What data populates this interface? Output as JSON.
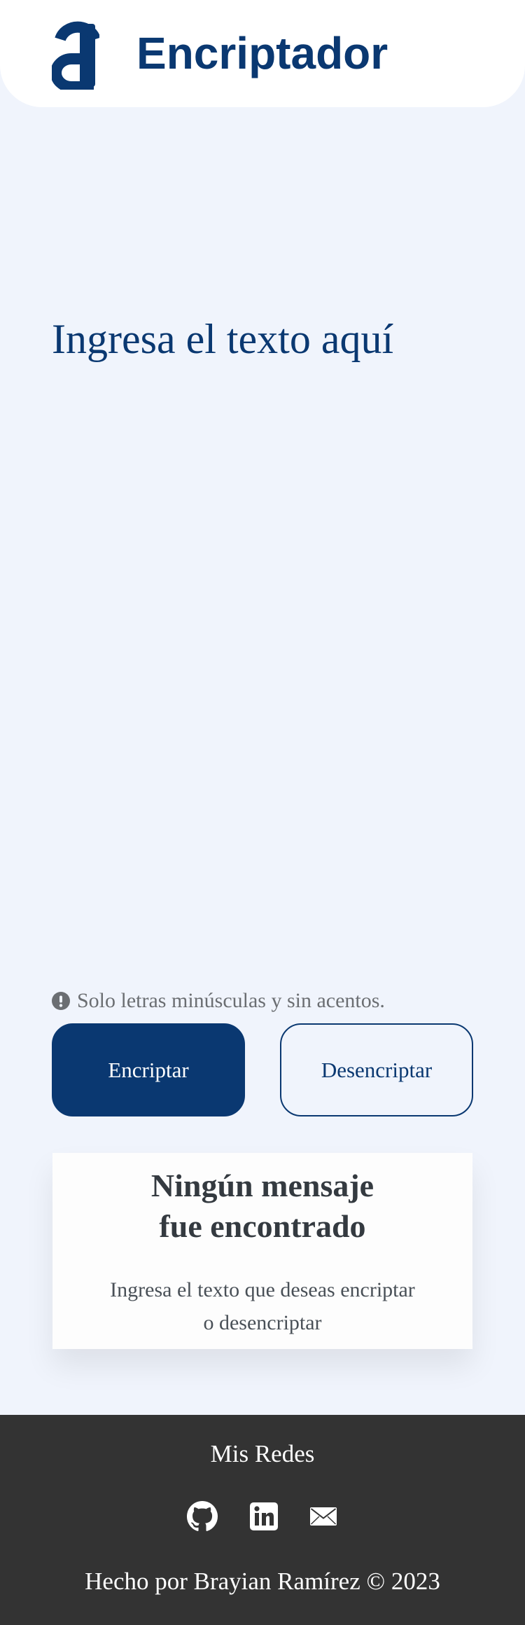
{
  "header": {
    "logo_icon": "alura-a-logo-icon",
    "brand": "Encriptador"
  },
  "input": {
    "placeholder": "Ingresa el texto aquí",
    "value": ""
  },
  "hint": {
    "icon": "exclamation-circle-icon",
    "text": "Solo letras minúsculas y sin acentos."
  },
  "actions": {
    "encrypt_label": "Encriptar",
    "decrypt_label": "Desencriptar"
  },
  "output": {
    "title_line1": "Ningún mensaje",
    "title_line2": "fue encontrado",
    "desc_line1": "Ingresa el texto que deseas encriptar",
    "desc_line2": "o desencriptar"
  },
  "footer": {
    "title": "Mis Redes",
    "social": [
      {
        "icon": "github-icon"
      },
      {
        "icon": "linkedin-icon"
      },
      {
        "icon": "mail-icon"
      }
    ],
    "credit": "Hecho por Brayian Ramírez © 2023"
  },
  "colors": {
    "primary": "#0a3871",
    "background": "#f0f4fc",
    "footer_bg": "#333333",
    "hint_text": "#6b6e72",
    "card_title": "#343a40"
  }
}
